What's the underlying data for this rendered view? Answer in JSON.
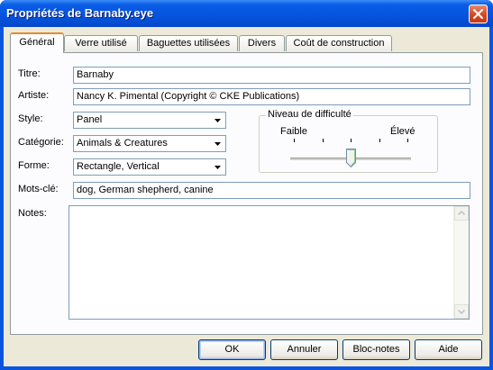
{
  "window": {
    "title": "Propriétés de Barnaby.eye"
  },
  "tabs": [
    {
      "label": "Général",
      "active": true
    },
    {
      "label": "Verre utilisé",
      "active": false
    },
    {
      "label": "Baguettes utilisées",
      "active": false
    },
    {
      "label": "Divers",
      "active": false
    },
    {
      "label": "Coût de construction",
      "active": false
    }
  ],
  "form": {
    "titre_label": "Titre:",
    "titre_value": "Barnaby",
    "artiste_label": "Artiste:",
    "artiste_value": "Nancy K. Pimental (Copyright © CKE Publications)",
    "style_label": "Style:",
    "style_value": "Panel",
    "categorie_label": "Catégorie:",
    "categorie_value": "Animals & Creatures",
    "forme_label": "Forme:",
    "forme_value": "Rectangle, Vertical",
    "motscle_label": "Mots-clé:",
    "motscle_value": "dog, German shepherd, canine",
    "notes_label": "Notes:",
    "notes_value": ""
  },
  "difficulty": {
    "group_title": "Niveau de difficulté",
    "min_label": "Faible",
    "max_label": "Élevé",
    "level": 0.5,
    "ticks": 5
  },
  "buttons": {
    "ok": "OK",
    "cancel": "Annuler",
    "notepad": "Bloc-notes",
    "help": "Aide"
  },
  "colors": {
    "titlebar": "#0653dd",
    "close": "#d7461f",
    "face": "#ece9d8",
    "active_tab_accent": "#e68b2c"
  }
}
